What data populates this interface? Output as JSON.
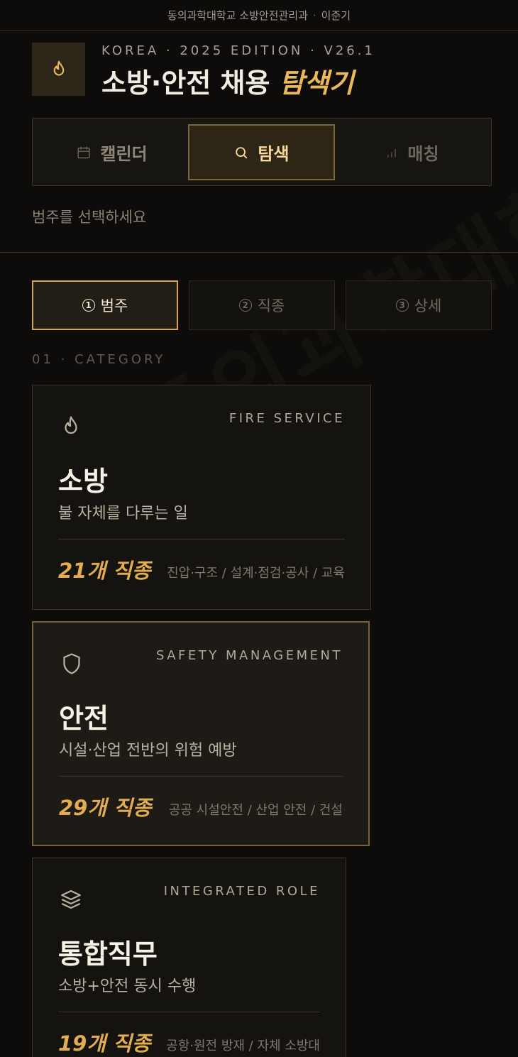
{
  "topbar": {
    "org": "동의과학대학교 소방안전관리과",
    "separator": "·",
    "author": "이준기"
  },
  "brand": {
    "logo_icon": "flame-icon",
    "edition": "KOREA · 2025 EDITION · V26.1",
    "title_main": "소방·안전 채용",
    "title_accent": "탐색기",
    "accent_color": "#e9b95c"
  },
  "tabs": [
    {
      "label": "캘린더",
      "icon": "calendar-icon",
      "active": false
    },
    {
      "label": "탐색",
      "icon": "search-icon",
      "active": true
    },
    {
      "label": "매칭",
      "icon": "bar-chart-icon",
      "active": false
    }
  ],
  "hint": "범주를 선택하세요",
  "steps": [
    {
      "num": "1",
      "label": "범주",
      "active": true
    },
    {
      "num": "2",
      "label": "직종",
      "active": false
    },
    {
      "num": "3",
      "label": "상세",
      "active": false
    }
  ],
  "section_label": "01 · CATEGORY",
  "categories": [
    {
      "icon": "flame-icon",
      "en": "FIRE SERVICE",
      "ko": "소방",
      "desc": "불 자체를 다루는 일",
      "count": "21개 직종",
      "roles": "진압·구조 / 설계·점검·공사 / 교육"
    },
    {
      "icon": "shield-icon",
      "en": "SAFETY MANAGEMENT",
      "ko": "안전",
      "desc": "시설·산업 전반의 위험 예방",
      "count": "29개 직종",
      "roles": "공공 시설안전 / 산업 안전 / 건설"
    },
    {
      "icon": "layers-icon",
      "en": "INTEGRATED ROLE",
      "ko": "통합직무",
      "desc": "소방+안전 동시 수행",
      "count": "19개 직종",
      "roles": "공항·원전 방재 / 자체 소방대"
    }
  ]
}
